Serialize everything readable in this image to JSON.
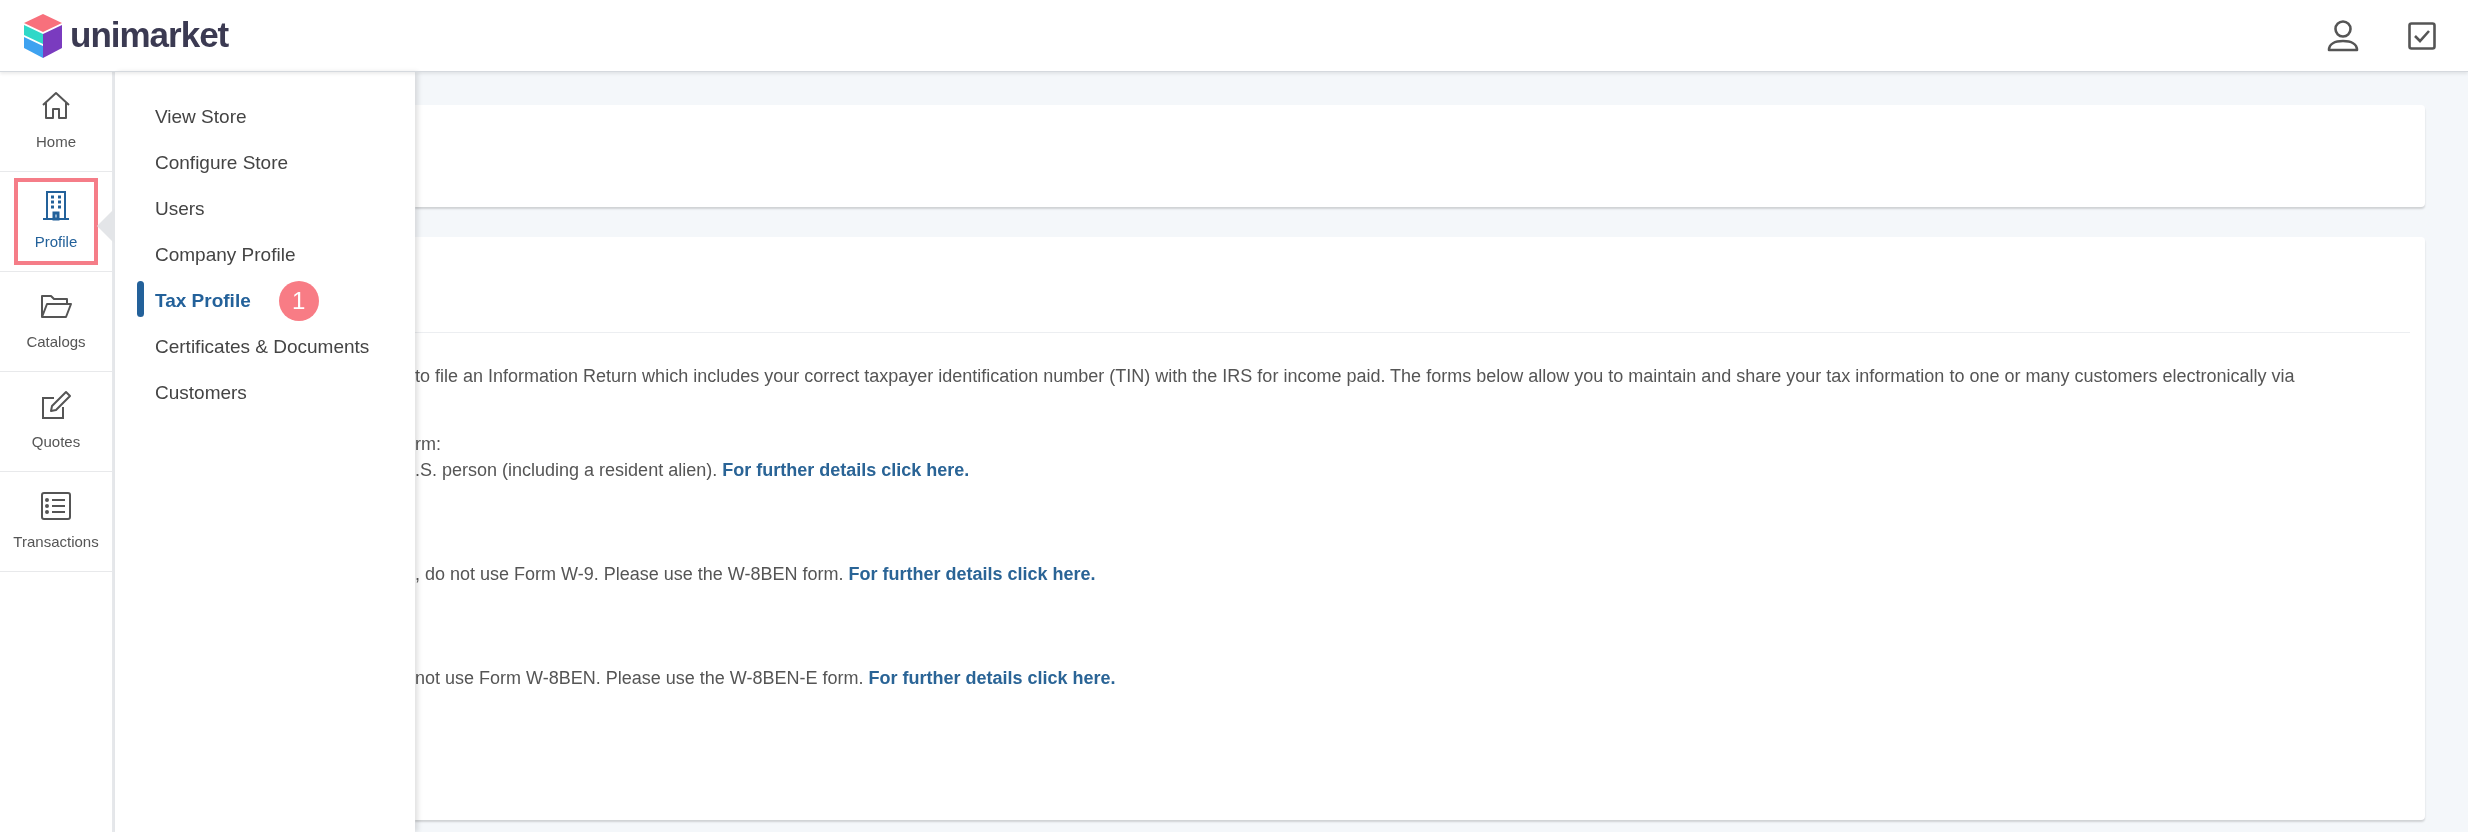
{
  "header": {
    "logo_text": "unimarket"
  },
  "rail": [
    {
      "label": "Home",
      "selected": false,
      "highlighted": false
    },
    {
      "label": "Profile",
      "selected": true,
      "highlighted": true
    },
    {
      "label": "Catalogs",
      "selected": false,
      "highlighted": false
    },
    {
      "label": "Quotes",
      "selected": false,
      "highlighted": false
    },
    {
      "label": "Transactions",
      "selected": false,
      "highlighted": false
    }
  ],
  "submenu": [
    {
      "label": "View Store",
      "selected": false
    },
    {
      "label": "Configure Store",
      "selected": false
    },
    {
      "label": "Users",
      "selected": false
    },
    {
      "label": "Company Profile",
      "selected": false
    },
    {
      "label": "Tax Profile",
      "selected": true,
      "badge": "1"
    },
    {
      "label": "Certificates & Documents",
      "selected": false
    },
    {
      "label": "Customers",
      "selected": false
    }
  ],
  "tax_card": {
    "paragraphs": [
      {
        "lines": [
          "to file an Information Return which includes your correct taxpayer identification number (TIN) with the IRS for income paid. The forms below allow you to maintain and share your tax information to one or many customers electronically via"
        ]
      },
      {
        "lines": [
          "rm:",
          ".S. person (including a resident alien)."
        ],
        "link": "For further details click here."
      },
      {
        "lines": [
          ", do not use Form W-9. Please use the W-8BEN form."
        ],
        "link": "For further details click here."
      },
      {
        "lines": [
          "not use Form W-8BEN. Please use the W-8BEN-E form."
        ],
        "link": "For further details click here."
      }
    ]
  }
}
